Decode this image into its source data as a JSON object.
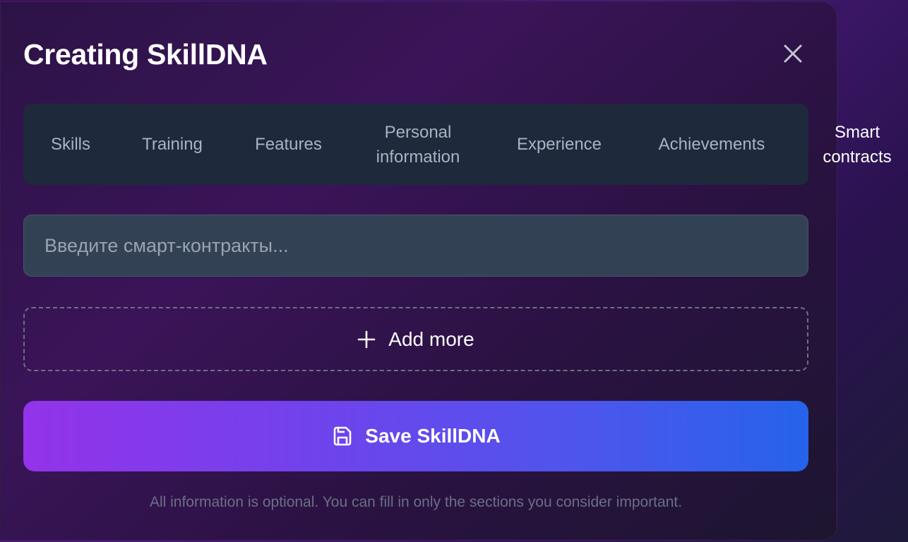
{
  "modal": {
    "title": "Creating SkillDNA",
    "close_icon": "close-icon"
  },
  "tabs": [
    {
      "label": "Skills",
      "active": false
    },
    {
      "label": "Training",
      "active": false
    },
    {
      "label": "Features",
      "active": false
    },
    {
      "label": "Personal\ninformation",
      "active": false
    },
    {
      "label": "Experience",
      "active": false
    },
    {
      "label": "Achievements",
      "active": false
    },
    {
      "label": "Smart\ncontracts",
      "active": true
    }
  ],
  "smart_contracts_input": {
    "value": "",
    "placeholder": "Введите смарт-контракты..."
  },
  "add_more": {
    "label": "Add more",
    "icon": "plus-icon"
  },
  "save": {
    "label": "Save SkillDNA",
    "icon": "save-icon"
  },
  "footnote": "All information is optional. You can fill in only the sections you consider important.",
  "colors": {
    "tab_bar_bg": "#1e293b",
    "input_bg": "#334155",
    "save_gradient_start": "#9333ea",
    "save_gradient_end": "#2563eb",
    "tab_inactive": "#aab3c2",
    "tab_active": "#ffffff"
  }
}
